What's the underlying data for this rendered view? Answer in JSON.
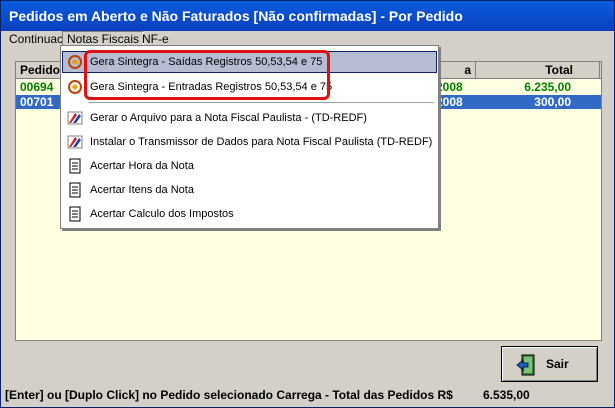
{
  "window": {
    "title": "Pedidos em Aberto e Não Faturados [Não confirmadas] - Por Pedido"
  },
  "menubar": {
    "items": [
      "Continuac",
      "Notas Fiscais",
      "NF-e"
    ],
    "active_index": 1
  },
  "grid": {
    "columns": [
      "Pedido",
      "a",
      "Total"
    ],
    "rows": [
      {
        "pedido": "00694",
        "date": "2008",
        "total": "6.235,00",
        "selected": false
      },
      {
        "pedido": "00701",
        "date": "2008",
        "total": "300,00",
        "selected": true
      }
    ]
  },
  "popup_menu": {
    "items": [
      {
        "label": "Gera Sintegra - Saídas Registros 50,53,54 e 75",
        "icon": "sintegra-icon",
        "highlighted": true
      },
      {
        "label": "Gera Sintegra - Entradas Registros 50,53,54 e 75",
        "icon": "sintegra-icon",
        "highlighted": false
      },
      {
        "label": "Gerar o Arquivo para a Nota Fiscal Paulista - (TD-REDF)",
        "icon": "nfp-icon",
        "highlighted": false
      },
      {
        "label": "Instalar o Transmissor de Dados para Nota Fiscal Paulista (TD-REDF)",
        "icon": "nfp-icon",
        "highlighted": false
      },
      {
        "label": "Acertar Hora da Nota",
        "icon": "document-icon",
        "highlighted": false
      },
      {
        "label": "Acertar Itens da Nota",
        "icon": "document-icon",
        "highlighted": false
      },
      {
        "label": "Acertar Calculo dos Impostos",
        "icon": "document-icon",
        "highlighted": false
      }
    ]
  },
  "buttons": {
    "sair_label": "Sair"
  },
  "statusbar": {
    "text": "[Enter] ou [Duplo Click] no Pedido selecionado Carrega - Total das Pedidos R$",
    "total": "6.535,00"
  },
  "colors": {
    "title_bar": "#0b3fbd",
    "grid_bg": "#ffffe1",
    "row_text": "#008000",
    "selection": "#316ac5",
    "highlight_box": "#e01010"
  }
}
